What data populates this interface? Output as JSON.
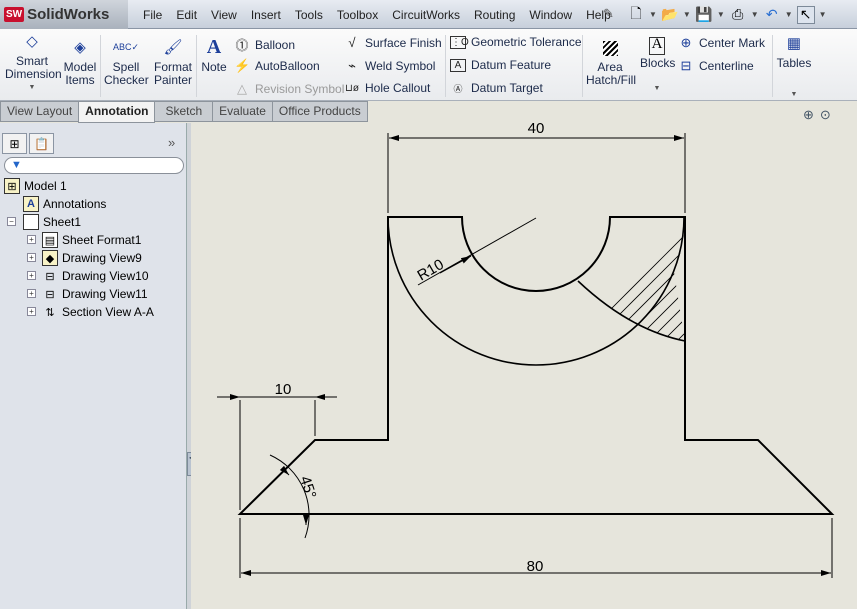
{
  "app": {
    "logo_badge": "SW",
    "name": "SolidWorks"
  },
  "menu": [
    "File",
    "Edit",
    "View",
    "Insert",
    "Tools",
    "Toolbox",
    "CircuitWorks",
    "Routing",
    "Window",
    "Help"
  ],
  "quick_access_icons": [
    "pin-icon",
    "new-document-icon",
    "open-icon",
    "save-icon",
    "print-icon",
    "undo-icon",
    "select-icon"
  ],
  "ribbon": {
    "smart_dimension": "Smart Dimension",
    "model_items": "Model Items",
    "spell_checker": "Spell Checker",
    "format_painter": "Format Painter",
    "note": "Note",
    "balloon": "Balloon",
    "autoballoon": "AutoBalloon",
    "revision_symbol": "Revision Symbol",
    "surface_finish": "Surface Finish",
    "weld_symbol": "Weld Symbol",
    "hole_callout": "Hole Callout",
    "geometric_tolerance": "Geometric Tolerance",
    "datum_feature": "Datum Feature",
    "datum_target": "Datum Target",
    "area_hatch": "Area Hatch/Fill",
    "blocks": "Blocks",
    "center_mark": "Center Mark",
    "centerline": "Centerline",
    "tables": "Tables"
  },
  "tabs": [
    {
      "label": "View Layout"
    },
    {
      "label": "Annotation",
      "active": true
    },
    {
      "label": "Sketch"
    },
    {
      "label": "Evaluate"
    },
    {
      "label": "Office Products"
    }
  ],
  "tree": {
    "root": "Model 1",
    "items": [
      "Annotations",
      "Sheet1",
      "Sheet Format1",
      "Drawing View9",
      "Drawing View10",
      "Drawing View11",
      "Section View A-A"
    ]
  },
  "drawing": {
    "dim_top": "40",
    "dim_left": "10",
    "dim_angle": "45°",
    "dim_bottom": "80",
    "radius": "R10"
  },
  "colors": {
    "line": "#000000",
    "background": "#e6e5dc",
    "accent": "#1d3f9a"
  }
}
